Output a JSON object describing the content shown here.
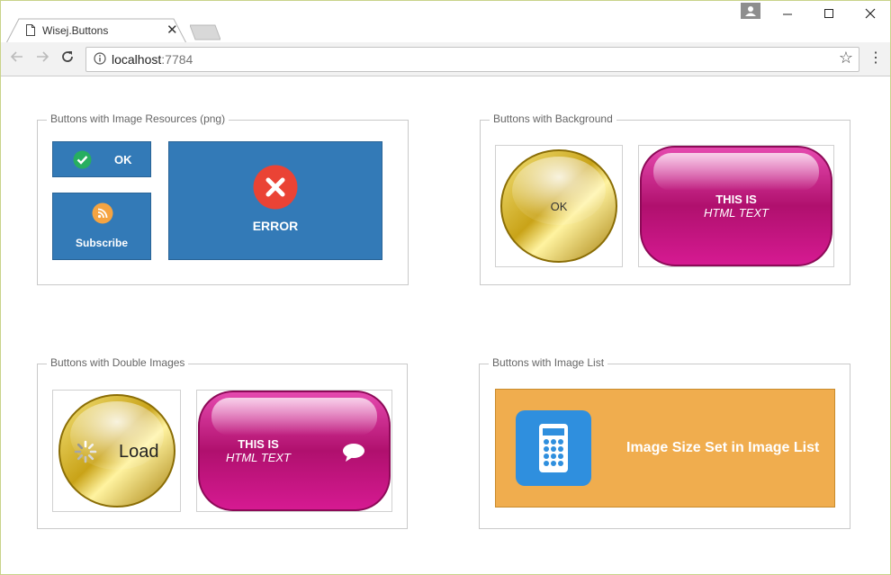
{
  "browser": {
    "tab_title": "Wisej.Buttons",
    "url_host": "localhost",
    "url_port": ":7784"
  },
  "groups": {
    "image_resources": {
      "legend": "Buttons with Image Resources (png)",
      "ok_label": "OK",
      "subscribe_label": "Subscribe",
      "error_label": "ERROR"
    },
    "background": {
      "legend": "Buttons with Background",
      "ok_label": "OK",
      "html_line1": "THIS IS",
      "html_line2": "HTML TEXT"
    },
    "double_images": {
      "legend": "Buttons with Double Images",
      "load_label": "Load",
      "html_line1": "THIS IS",
      "html_line2": "HTML TEXT"
    },
    "image_list": {
      "legend": "Buttons with Image List",
      "label": "Image Size Set in Image List"
    }
  },
  "colors": {
    "blue_button": "#337ab7",
    "orange_button": "#f0ad4e",
    "calculator_tile": "#2f8fde",
    "error_icon": "#e74c3c",
    "ok_check": "#27ae60",
    "rss_icon": "#f39c12"
  }
}
